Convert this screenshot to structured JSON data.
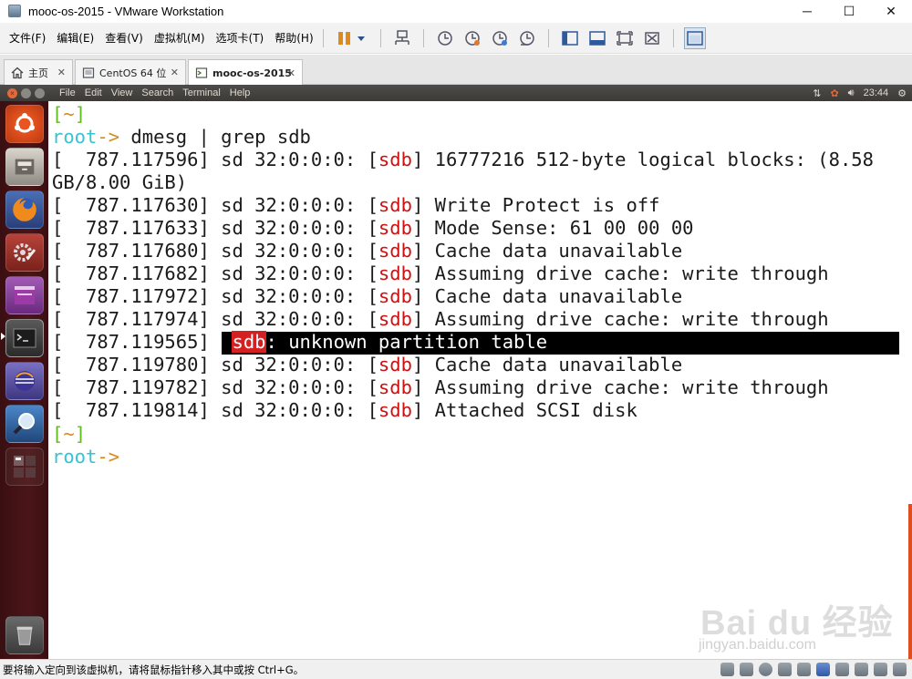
{
  "window": {
    "title": "mooc-os-2015 - VMware Workstation",
    "controls": {
      "minimize": "─",
      "maximize": "☐",
      "close": "✕"
    }
  },
  "menubar": {
    "items": [
      "文件(F)",
      "编辑(E)",
      "查看(V)",
      "虚拟机(M)",
      "选项卡(T)",
      "帮助(H)"
    ]
  },
  "tabs": [
    {
      "label": "主页",
      "close": "✕"
    },
    {
      "label": "CentOS 64 位",
      "close": "✕"
    },
    {
      "label": "mooc-os-2015",
      "close": "✕"
    }
  ],
  "guest_panel": {
    "menus": [
      "File",
      "Edit",
      "View",
      "Search",
      "Terminal",
      "Help"
    ],
    "clock": "23:44"
  },
  "terminal": {
    "bracket_open": "[",
    "tilde": "~",
    "bracket_close": "]",
    "prompt_user": "root",
    "prompt_arrow": "->",
    "command": "dmesg | grep sdb",
    "dev": "sdb",
    "lines": [
      {
        "ts": "[  787.117596] sd 32:0:0:0: ",
        "msg": " 16777216 512-byte logical blocks: (8.58"
      },
      {
        "ts": "[  787.117630] sd 32:0:0:0: ",
        "msg": " Write Protect is off"
      },
      {
        "ts": "[  787.117633] sd 32:0:0:0: ",
        "msg": " Mode Sense: 61 00 00 00"
      },
      {
        "ts": "[  787.117680] sd 32:0:0:0: ",
        "msg": " Cache data unavailable"
      },
      {
        "ts": "[  787.117682] sd 32:0:0:0: ",
        "msg": " Assuming drive cache: write through"
      },
      {
        "ts": "[  787.117972] sd 32:0:0:0: ",
        "msg": " Cache data unavailable"
      },
      {
        "ts": "[  787.117974] sd 32:0:0:0: ",
        "msg": " Assuming drive cache: write through"
      },
      {
        "ts": "[  787.119780] sd 32:0:0:0: ",
        "msg": " Cache data unavailable"
      },
      {
        "ts": "[  787.119782] sd 32:0:0:0: ",
        "msg": " Assuming drive cache: write through"
      },
      {
        "ts": "[  787.119814] sd 32:0:0:0: ",
        "msg": " Attached SCSI disk"
      }
    ],
    "wrap_continuation": "GB/8.00 GiB)",
    "partition_line": {
      "ts": "[  787.119565] ",
      "msg": ": unknown partition table"
    }
  },
  "statusbar": {
    "text": "要将输入定向到该虚拟机，请将鼠标指针移入其中或按 Ctrl+G。"
  },
  "watermark": {
    "logo": "Bai du 经验",
    "url": "jingyan.baidu.com"
  },
  "colors": {
    "launcher_bg": "#4b1518",
    "prompt_green": "#5fbb1f",
    "prompt_cyan": "#34c4d4",
    "sdb_red": "#d01010",
    "selection_bg": "#000000"
  }
}
